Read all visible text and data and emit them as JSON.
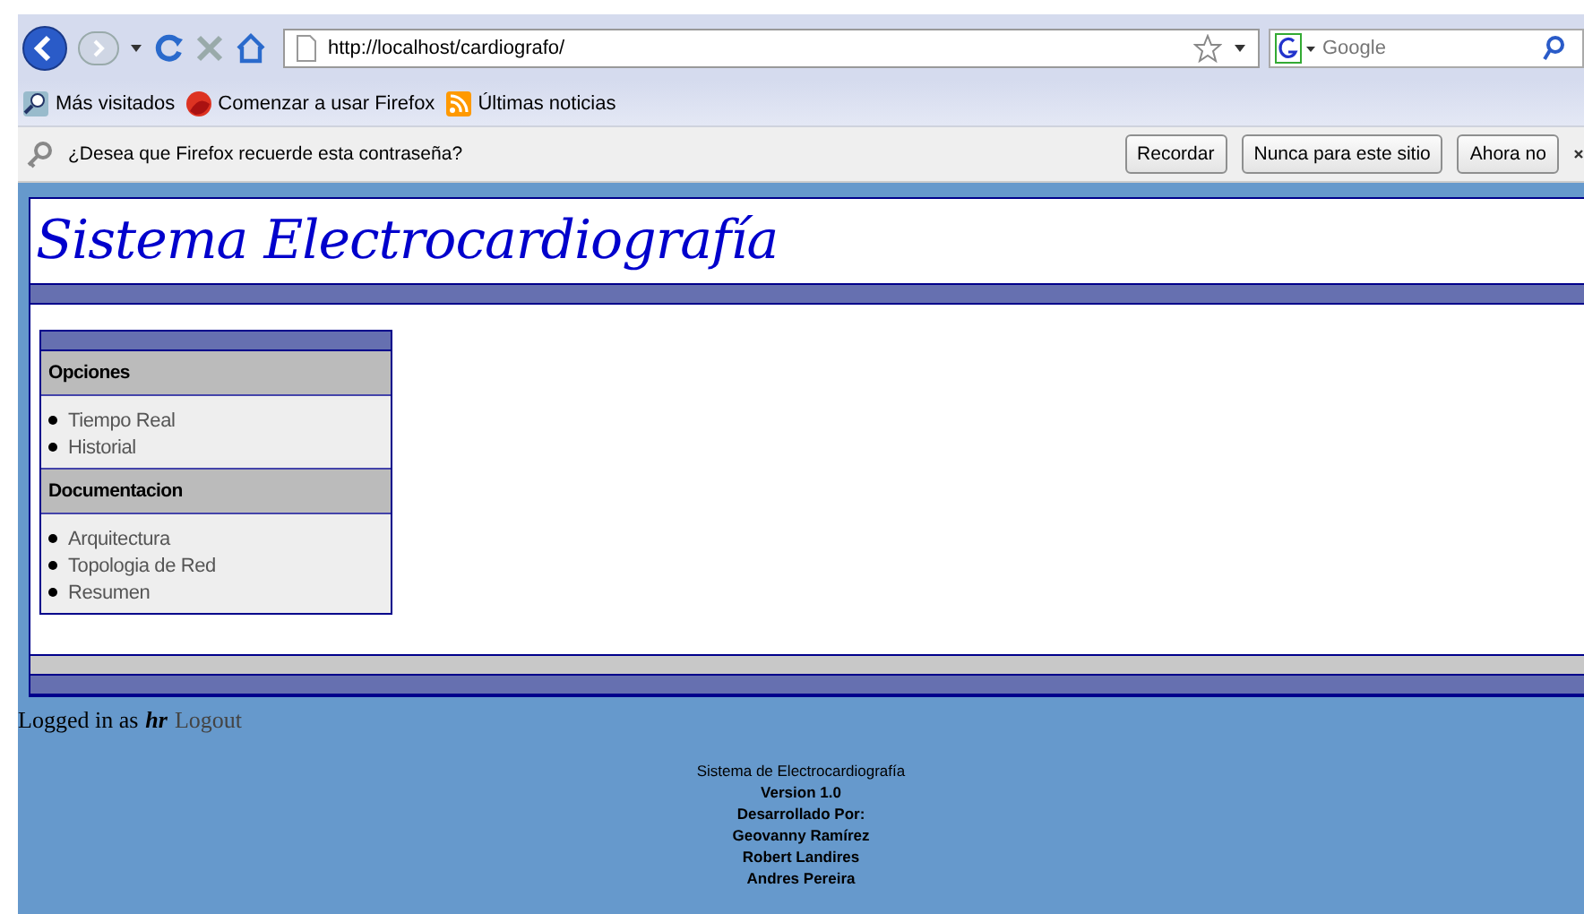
{
  "browser": {
    "url": "http://localhost/cardiografo/",
    "search_placeholder": "Google",
    "bookmarks": [
      {
        "label": "Más visitados",
        "kind": "search"
      },
      {
        "label": "Comenzar a usar Firefox",
        "kind": "firefox"
      },
      {
        "label": "Últimas noticias",
        "kind": "feed"
      }
    ],
    "password_bar": {
      "message": "¿Desea que Firefox recuerde esta contraseña?",
      "buttons": [
        "Recordar",
        "Nunca para este sitio",
        "Ahora no"
      ]
    }
  },
  "page": {
    "title": "Sistema Electrocardiografía",
    "menu": [
      {
        "heading": "Opciones",
        "items": [
          "Tiempo Real",
          "Historial"
        ]
      },
      {
        "heading": "Documentacion",
        "items": [
          "Arquitectura",
          "Topologia de Red",
          "Resumen"
        ]
      }
    ],
    "login": {
      "prefix": "Logged in as",
      "user": "hr",
      "logout": "Logout"
    },
    "footer": [
      "Sistema de Electrocardiografía",
      "Version 1.0",
      "Desarrollado Por:",
      "Geovanny Ramírez",
      "Robert Landires",
      "Andres Pereira"
    ]
  }
}
